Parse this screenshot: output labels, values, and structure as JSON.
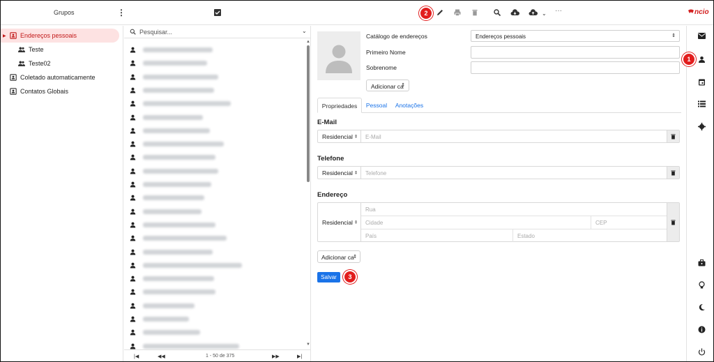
{
  "topbar": {
    "groups_title": "Grupos",
    "logo_text": "ncio",
    "badge_2": "2"
  },
  "groups": [
    {
      "label": "Endereços pessoais",
      "active": true,
      "indent": 0
    },
    {
      "label": "Teste",
      "active": false,
      "indent": 1
    },
    {
      "label": "Teste02",
      "active": false,
      "indent": 1
    },
    {
      "label": "Coletado automaticamente",
      "active": false,
      "indent": 0
    },
    {
      "label": "Contatos Globais",
      "active": false,
      "indent": 0
    }
  ],
  "list": {
    "search_placeholder": "Pesquisar...",
    "contact_count_visible": 23,
    "pager_text": "1 - 50 de 375"
  },
  "detail": {
    "catalog_label": "Catálogo de endereços",
    "catalog_value": "Endereços pessoais",
    "first_name_label": "Primeiro Nome",
    "first_name_value": "",
    "last_name_label": "Sobrenome",
    "last_name_value": "",
    "add_field_label": "Adicionar ca",
    "tabs": [
      "Propriedades",
      "Pessoal",
      "Anotações"
    ],
    "email": {
      "title": "E-Mail",
      "type": "Residencial",
      "placeholder": "E-Mail"
    },
    "phone": {
      "title": "Telefone",
      "type": "Residencial",
      "placeholder": "Telefone"
    },
    "address": {
      "title": "Endereço",
      "type": "Residencial",
      "street_placeholder": "Rua",
      "city_placeholder": "Cidade",
      "zip_placeholder": "CEP",
      "country_placeholder": "País",
      "state_placeholder": "Estado"
    },
    "add_field_bottom_label": "Adicionar ca",
    "save_label": "Salvar",
    "badge_3": "3"
  },
  "rail": {
    "badge_1": "1"
  },
  "colors": {
    "accent": "#1a73e8",
    "badge": "#e21d1d",
    "active_group_bg": "#fde2e2",
    "active_group_text": "#c21818"
  }
}
